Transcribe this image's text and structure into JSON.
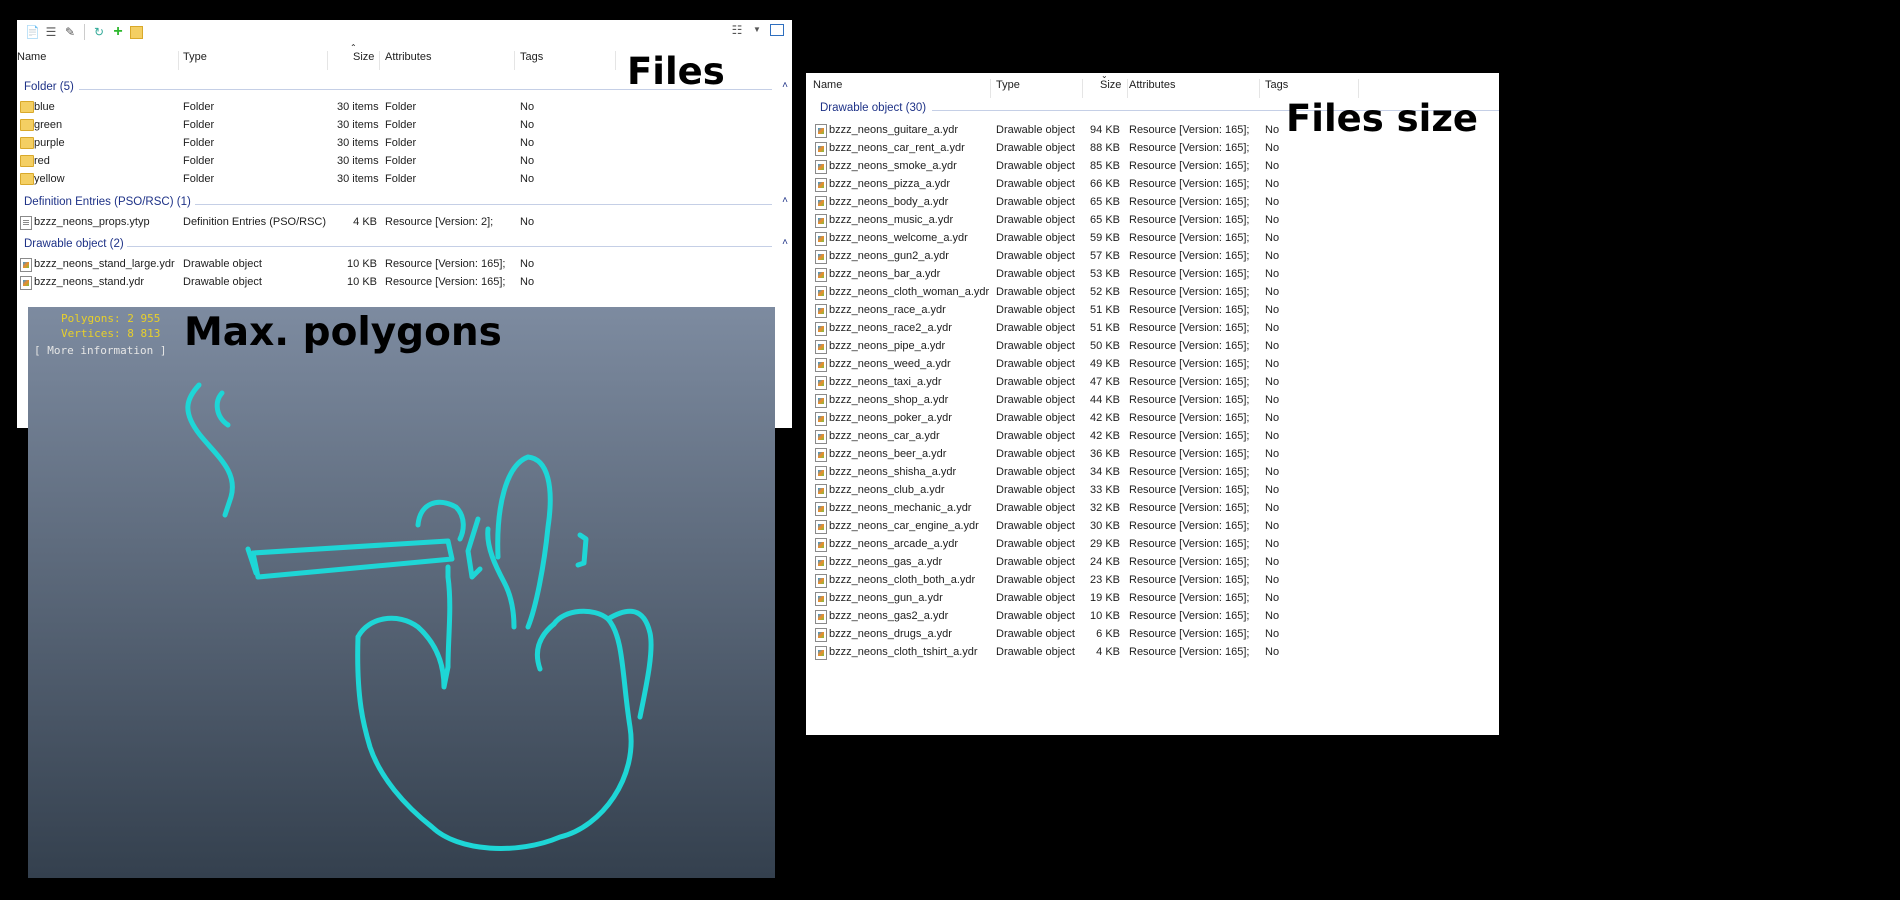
{
  "left_panel": {
    "columns": [
      "Name",
      "Type",
      "Size",
      "Attributes",
      "Tags"
    ],
    "annotation": "Files",
    "groups": [
      {
        "header": "Folder (5)",
        "rows": [
          {
            "icon": "folder-icon",
            "name": "blue",
            "type": "Folder",
            "size": "30 items",
            "attributes": "Folder",
            "tags": "No"
          },
          {
            "icon": "folder-icon",
            "name": "green",
            "type": "Folder",
            "size": "30 items",
            "attributes": "Folder",
            "tags": "No"
          },
          {
            "icon": "folder-icon",
            "name": "purple",
            "type": "Folder",
            "size": "30 items",
            "attributes": "Folder",
            "tags": "No"
          },
          {
            "icon": "folder-icon",
            "name": "red",
            "type": "Folder",
            "size": "30 items",
            "attributes": "Folder",
            "tags": "No"
          },
          {
            "icon": "folder-icon",
            "name": "yellow",
            "type": "Folder",
            "size": "30 items",
            "attributes": "Folder",
            "tags": "No"
          }
        ]
      },
      {
        "header": "Definition Entries (PSO/RSC) (1)",
        "rows": [
          {
            "icon": "document-icon",
            "name": "bzzz_neons_props.ytyp",
            "type": "Definition Entries (PSO/RSC)",
            "size": "4 KB",
            "attributes": "Resource [Version: 2];",
            "tags": "No"
          }
        ]
      },
      {
        "header": "Drawable object (2)",
        "rows": [
          {
            "icon": "drawable-file-icon",
            "name": "bzzz_neons_stand_large.ydr",
            "type": "Drawable object",
            "size": "10 KB",
            "attributes": "Resource [Version: 165];",
            "tags": "No"
          },
          {
            "icon": "drawable-file-icon",
            "name": "bzzz_neons_stand.ydr",
            "type": "Drawable object",
            "size": "10 KB",
            "attributes": "Resource [Version: 165];",
            "tags": "No"
          }
        ]
      }
    ]
  },
  "viewport": {
    "polygons": "Polygons: 2 955",
    "vertices": "Vertices: 8 813",
    "more_info": "[ More information ]",
    "annotation": "Max. polygons",
    "neon_color": "#1ed6d6"
  },
  "right_panel": {
    "columns": [
      "Name",
      "Type",
      "Size",
      "Attributes",
      "Tags"
    ],
    "annotation": "Files size",
    "group_header": "Drawable object (30)",
    "rows": [
      {
        "name": "bzzz_neons_guitare_a.ydr",
        "size": "94 KB"
      },
      {
        "name": "bzzz_neons_car_rent_a.ydr",
        "size": "88 KB"
      },
      {
        "name": "bzzz_neons_smoke_a.ydr",
        "size": "85 KB"
      },
      {
        "name": "bzzz_neons_pizza_a.ydr",
        "size": "66 KB"
      },
      {
        "name": "bzzz_neons_body_a.ydr",
        "size": "65 KB"
      },
      {
        "name": "bzzz_neons_music_a.ydr",
        "size": "65 KB"
      },
      {
        "name": "bzzz_neons_welcome_a.ydr",
        "size": "59 KB"
      },
      {
        "name": "bzzz_neons_gun2_a.ydr",
        "size": "57 KB"
      },
      {
        "name": "bzzz_neons_bar_a.ydr",
        "size": "53 KB"
      },
      {
        "name": "bzzz_neons_cloth_woman_a.ydr",
        "size": "52 KB"
      },
      {
        "name": "bzzz_neons_race_a.ydr",
        "size": "51 KB"
      },
      {
        "name": "bzzz_neons_race2_a.ydr",
        "size": "51 KB"
      },
      {
        "name": "bzzz_neons_pipe_a.ydr",
        "size": "50 KB"
      },
      {
        "name": "bzzz_neons_weed_a.ydr",
        "size": "49 KB"
      },
      {
        "name": "bzzz_neons_taxi_a.ydr",
        "size": "47 KB"
      },
      {
        "name": "bzzz_neons_shop_a.ydr",
        "size": "44 KB"
      },
      {
        "name": "bzzz_neons_poker_a.ydr",
        "size": "42 KB"
      },
      {
        "name": "bzzz_neons_car_a.ydr",
        "size": "42 KB"
      },
      {
        "name": "bzzz_neons_beer_a.ydr",
        "size": "36 KB"
      },
      {
        "name": "bzzz_neons_shisha_a.ydr",
        "size": "34 KB"
      },
      {
        "name": "bzzz_neons_club_a.ydr",
        "size": "33 KB"
      },
      {
        "name": "bzzz_neons_mechanic_a.ydr",
        "size": "32 KB"
      },
      {
        "name": "bzzz_neons_car_engine_a.ydr",
        "size": "30 KB"
      },
      {
        "name": "bzzz_neons_arcade_a.ydr",
        "size": "29 KB"
      },
      {
        "name": "bzzz_neons_gas_a.ydr",
        "size": "24 KB"
      },
      {
        "name": "bzzz_neons_cloth_both_a.ydr",
        "size": "23 KB"
      },
      {
        "name": "bzzz_neons_gun_a.ydr",
        "size": "19 KB"
      },
      {
        "name": "bzzz_neons_gas2_a.ydr",
        "size": "10 KB"
      },
      {
        "name": "bzzz_neons_drugs_a.ydr",
        "size": "6 KB"
      },
      {
        "name": "bzzz_neons_cloth_tshirt_a.ydr",
        "size": "4 KB"
      }
    ],
    "row_type": "Drawable object",
    "row_attributes": "Resource [Version: 165];",
    "row_tags": "No"
  },
  "colors": {
    "group_header": "#1e3287",
    "folder": "#f4cf63",
    "background": "#000000"
  }
}
